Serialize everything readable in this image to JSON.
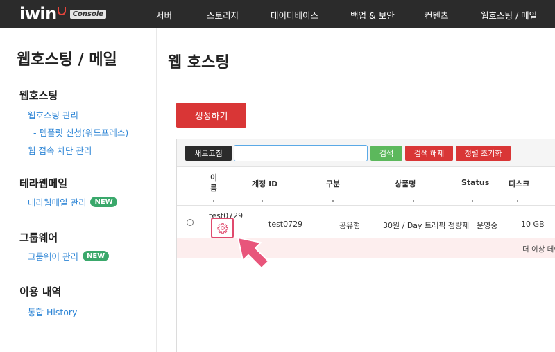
{
  "header": {
    "logo_text": "iwin",
    "logo_badge": "Console",
    "nav": [
      "서버",
      "스토리지",
      "데이터베이스",
      "백업 & 보안",
      "컨텐츠",
      "웹호스팅 / 메일"
    ]
  },
  "sidebar": {
    "title": "웹호스팅 / 메일",
    "sections": [
      {
        "label": "웹호스팅",
        "links": [
          "웹호스팅 관리",
          "- 템플릿 신청(워드프레스)",
          "웹 접속 차단 관리"
        ]
      },
      {
        "label": "테라웹메일",
        "links": [
          "테라웹메일 관리"
        ],
        "badge": "NEW"
      },
      {
        "label": "그룹웨어",
        "links": [
          "그룹웨어 관리"
        ],
        "badge": "NEW"
      },
      {
        "label": "이용 내역",
        "links": [
          "통합 History"
        ]
      }
    ]
  },
  "main": {
    "title": "웹 호스팅",
    "create_button": "생성하기",
    "toolbar": {
      "refresh": "새로고침",
      "search_value": "",
      "search": "검색",
      "search_clear": "검색 해제",
      "sort_reset": "정렬 초기화"
    },
    "table": {
      "columns": [
        "이\n름",
        "계정 ID",
        "구분",
        "상품명",
        "Status",
        "디스크"
      ],
      "rows": [
        {
          "name": "test0729",
          "account_id": "test0729",
          "type": "공유형",
          "product": "30원 / Day 트래픽 정량제",
          "status": "운영중",
          "disk": "10 GB"
        }
      ],
      "empty_message": "더 이상 데이"
    }
  },
  "colors": {
    "primary_red": "#d93636",
    "search_green": "#5cb85c",
    "dark_button": "#2b2b2b",
    "link_blue": "#2f86d6",
    "highlight_pink": "#e04a6d"
  },
  "icons": {
    "gear": "gear-icon",
    "arrow": "pointer-arrow-icon"
  }
}
